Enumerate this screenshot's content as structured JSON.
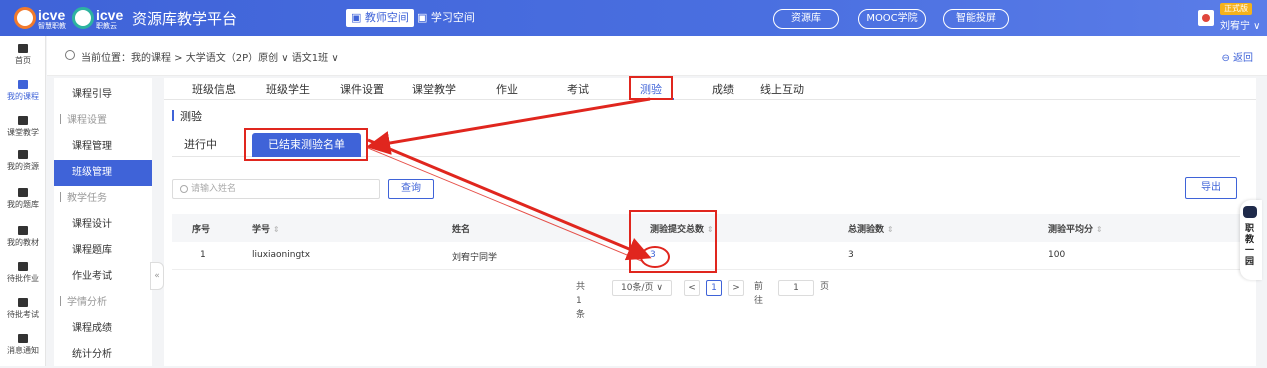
{
  "header": {
    "logo_icve": "icve",
    "logo_icve_sub": "智慧职教",
    "logo_icve2": "icve",
    "logo_icve2_sub": "职教云",
    "platform_title": "资源库教学平台",
    "teacher_space": "教师空间",
    "student_space": "学习空间",
    "pills": [
      "资源库",
      "MOOC学院",
      "智能投屏"
    ],
    "user_badge": "正式版",
    "user_name": "刘宥宁"
  },
  "leftnav": [
    {
      "label": "首页",
      "icon": "home-icon"
    },
    {
      "label": "我的课程",
      "icon": "course-icon"
    },
    {
      "label": "课堂教学",
      "icon": "play-icon"
    },
    {
      "label": "我的资源",
      "icon": "resource-icon"
    },
    {
      "label": "我的题库",
      "icon": "question-bank-icon"
    },
    {
      "label": "我的教材",
      "icon": "textbook-icon"
    },
    {
      "label": "待批作业",
      "icon": "homework-icon"
    },
    {
      "label": "待批考试",
      "icon": "exam-icon"
    },
    {
      "label": "消息通知",
      "icon": "message-icon"
    }
  ],
  "breadcrumb": {
    "text": "当前位置：我的课程 > 大学语文（2P）原创 ∨ 语文1班 ∨",
    "back": "返回"
  },
  "subnav": [
    {
      "label": "课程引导",
      "type": "item"
    },
    {
      "label": "课程设置",
      "type": "group"
    },
    {
      "label": "课程管理",
      "type": "item"
    },
    {
      "label": "班级管理",
      "type": "item",
      "active": true
    },
    {
      "label": "教学任务",
      "type": "group"
    },
    {
      "label": "课程设计",
      "type": "item"
    },
    {
      "label": "课程题库",
      "type": "item"
    },
    {
      "label": "作业考试",
      "type": "item"
    },
    {
      "label": "学情分析",
      "type": "group"
    },
    {
      "label": "课程成绩",
      "type": "item"
    },
    {
      "label": "统计分析",
      "type": "item"
    }
  ],
  "tabs": [
    "班级信息",
    "班级学生",
    "课件设置",
    "课堂教学",
    "作业",
    "考试",
    "测验",
    "成绩",
    "线上互动"
  ],
  "active_tab": "测验",
  "section_title": "测验",
  "subtabs": {
    "ongoing": "进行中",
    "ended": "已结束测验名单"
  },
  "search": {
    "placeholder": "请输入姓名",
    "query_btn": "查询",
    "export_btn": "导出"
  },
  "table": {
    "headers": [
      "序号",
      "学号",
      "姓名",
      "测验提交总数",
      "总测验数",
      "测验平均分"
    ],
    "rows": [
      [
        "1",
        "liuxiaoningtx",
        "刘宥宁同学",
        "3",
        "3",
        "100"
      ]
    ]
  },
  "pager": {
    "total": "共 1 条",
    "page_size": "10条/页",
    "prev": "<",
    "current": "1",
    "next": ">",
    "goto_label": "前往",
    "goto_value": "1",
    "page_unit": "页"
  },
  "assistant": {
    "label": "职教一园"
  },
  "colors": {
    "primary": "#3f63d8",
    "annotation": "#e0261e"
  }
}
